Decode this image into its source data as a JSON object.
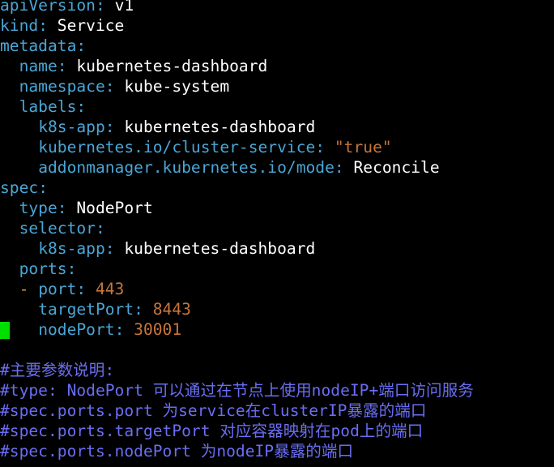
{
  "yaml": {
    "apiVersion_key": "apiVersion",
    "apiVersion_val": "v1",
    "kind_key": "kind",
    "kind_val": "Service",
    "metadata_key": "metadata",
    "name_key": "name",
    "name_val": "kubernetes-dashboard",
    "namespace_key": "namespace",
    "namespace_val": "kube-system",
    "labels_key": "labels",
    "k8sapp_key": "k8s-app",
    "k8sapp_val": "kubernetes-dashboard",
    "clusterservice_key": "kubernetes.io/cluster-service",
    "clusterservice_val": "\"true\"",
    "addonmanager_key": "addonmanager.kubernetes.io/mode",
    "addonmanager_val": "Reconcile",
    "spec_key": "spec",
    "type_key": "type",
    "type_val": "NodePort",
    "selector_key": "selector",
    "selector_k8sapp_key": "k8s-app",
    "selector_k8sapp_val": "kubernetes-dashboard",
    "ports_key": "ports",
    "port_dash": "-",
    "port_key": "port",
    "port_val": "443",
    "targetPort_key": "targetPort",
    "targetPort_val": "8443",
    "nodePort_key": "nodePort",
    "nodePort_val": "30001"
  },
  "comments": [
    "#主要参数说明:",
    "#type: NodePort 可以通过在节点上使用nodeIP+端口访问服务",
    "#spec.ports.port 为service在clusterIP暴露的端口",
    "#spec.ports.targetPort 对应容器映射在pod上的端口",
    "#spec.ports.nodePort 为nodeIP暴露的端口"
  ],
  "colors": {
    "background": "#000000",
    "key": "#4aa6d6",
    "value": "#ffffff",
    "number": "#c8763a",
    "comment": "#6a6ef2",
    "cursor": "#00e000"
  }
}
